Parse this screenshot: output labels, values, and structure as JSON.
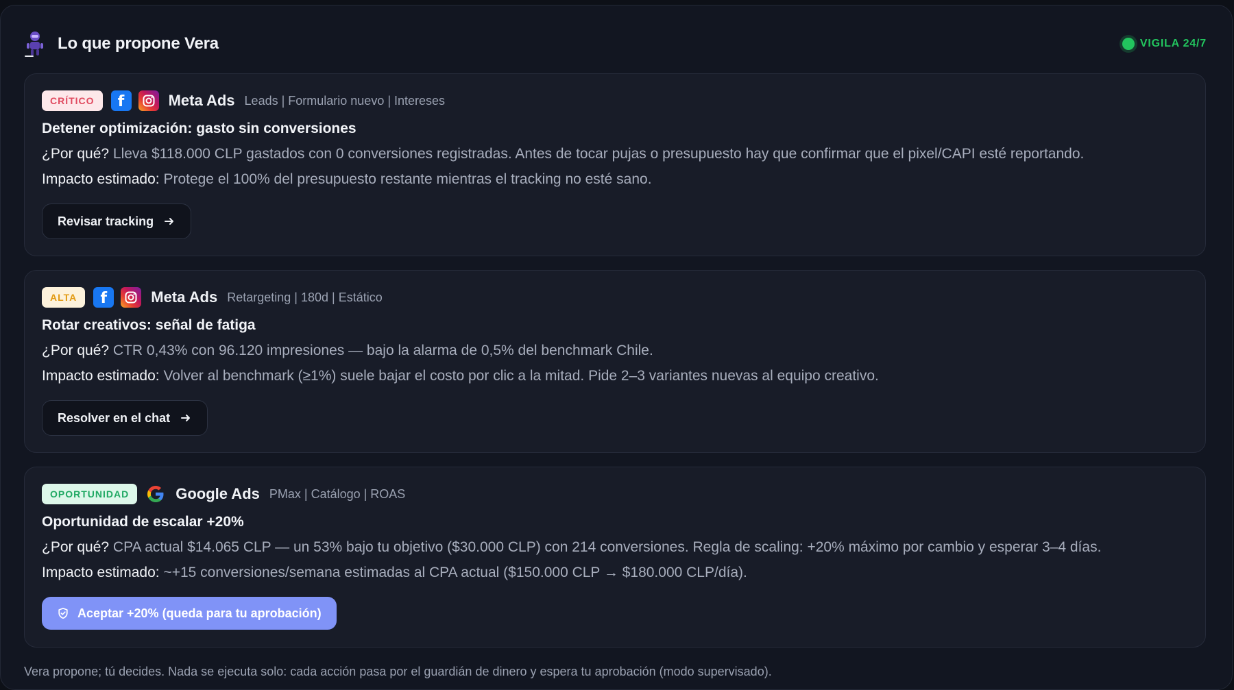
{
  "header": {
    "title": "Lo que propone Vera",
    "status": "VIGILA 24/7",
    "status_color": "#22c55e"
  },
  "cards": [
    {
      "badge": "CRÍTICO",
      "platform": "Meta Ads",
      "meta": "Leads | Formulario nuevo | Intereses",
      "title": "Detener optimización: gasto sin conversiones",
      "why_label": "¿Por qué?",
      "why": "Lleva $118.000 CLP gastados con 0 conversiones registradas. Antes de tocar pujas o presupuesto hay que confirmar que el pixel/CAPI esté reportando.",
      "impact_label": "Impacto estimado:",
      "impact": "Protege el 100% del presupuesto restante mientras el tracking no esté sano.",
      "button": "Revisar tracking",
      "icons": [
        "facebook-icon",
        "instagram-icon"
      ]
    },
    {
      "badge": "ALTA",
      "platform": "Meta Ads",
      "meta": "Retargeting | 180d | Estático",
      "title": "Rotar creativos: señal de fatiga",
      "why_label": "¿Por qué?",
      "why": "CTR 0,43% con 96.120 impresiones — bajo la alarma de 0,5% del benchmark Chile.",
      "impact_label": "Impacto estimado:",
      "impact": "Volver al benchmark (≥1%) suele bajar el costo por clic a la mitad. Pide 2–3 variantes nuevas al equipo creativo.",
      "button": "Resolver en el chat",
      "icons": [
        "facebook-icon",
        "instagram-icon"
      ]
    },
    {
      "badge": "OPORTUNIDAD",
      "platform": "Google Ads",
      "meta": "PMax | Catálogo | ROAS",
      "title": "Oportunidad de escalar +20%",
      "why_label": "¿Por qué?",
      "why": "CPA actual $14.065 CLP — un 53% bajo tu objetivo ($30.000 CLP) con 214 conversiones. Regla de scaling: +20% máximo por cambio y esperar 3–4 días.",
      "impact_label": "Impacto estimado:",
      "impact": "~+15 conversiones/semana estimadas al CPA actual ($150.000 CLP → $180.000 CLP/día).",
      "button": "Aceptar +20% (queda para tu aprobación)",
      "icons": [
        "google-icon",
        "shield-icon"
      ]
    }
  ],
  "footer": "Vera propone; tú decides. Nada se ejecuta solo: cada acción pasa por el guardián de dinero y espera tu aprobación (modo supervisado).",
  "colors": {
    "critico": "#e04a5f",
    "alta": "#e29a12",
    "oportunidad": "#1ea862",
    "primary_button": "#8093f7"
  }
}
